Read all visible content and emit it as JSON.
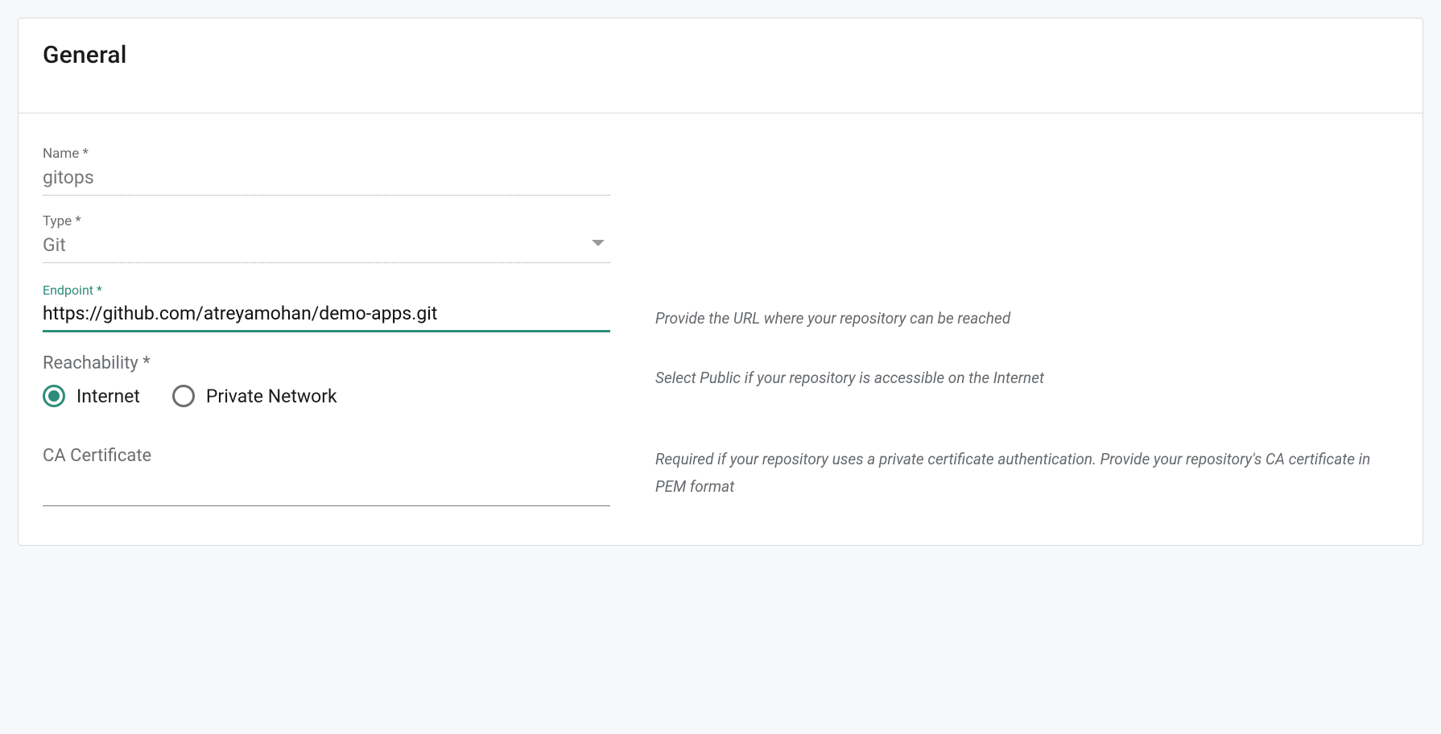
{
  "section_title": "General",
  "fields": {
    "name_label": "Name *",
    "name_value": "gitops",
    "type_label": "Type *",
    "type_value": "Git",
    "endpoint_label": "Endpoint *",
    "endpoint_value": "https://github.com/atreyamohan/demo-apps.git",
    "reachability_label": "Reachability *",
    "ca_label": "CA Certificate",
    "ca_value": ""
  },
  "reachability_options": {
    "internet": "Internet",
    "private": "Private Network",
    "selected": "internet"
  },
  "help": {
    "endpoint": "Provide the URL where your repository can be reached",
    "reachability": "Select Public if your repository is accessible on the Internet",
    "ca": "Required if your repository uses a private certificate authentication. Provide your repository's CA certificate in PEM format"
  }
}
